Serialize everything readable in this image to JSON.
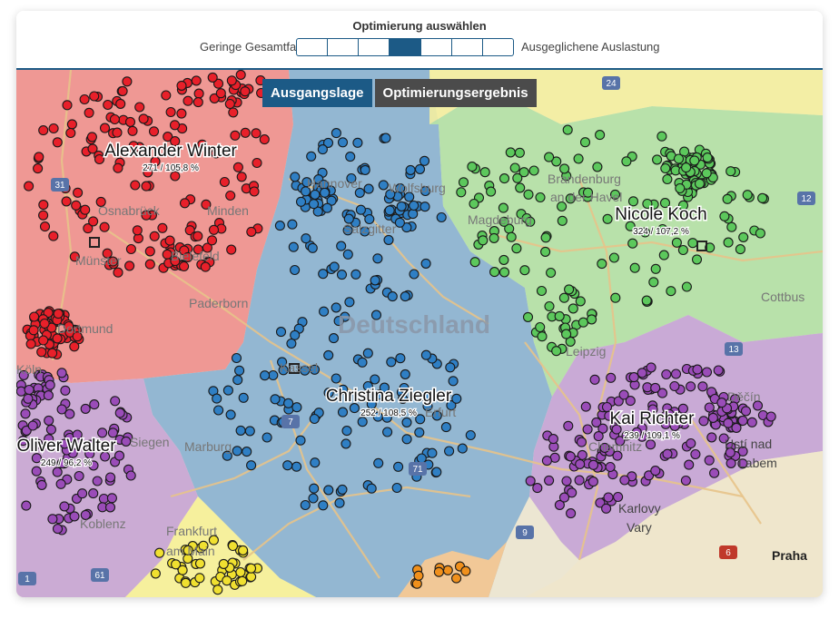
{
  "header": {
    "title": "Optimierung auswählen",
    "slider_left_label": "Geringe Gesamtfahrzeit",
    "slider_right_label": "Ausgeglichene Auslastung",
    "slider_segments": 7,
    "slider_selected_index": 3,
    "slider_color": "#1c5a86"
  },
  "tabs": [
    {
      "label": "Ausgangslage",
      "active": true
    },
    {
      "label": "Optimierungsergebnis",
      "active": false
    }
  ],
  "map": {
    "country_label": "Deutschland",
    "city_labels": [
      "Hannover",
      "Wolfsburg",
      "Osnabrück",
      "Minden",
      "Bielefeld",
      "Münster",
      "Paderborn",
      "Dortmund",
      "Köln",
      "Siegen",
      "Marburg",
      "Kassel",
      "Salzgitter",
      "Erfurt",
      "Magdeburg",
      "Brandenburg",
      "an der Havel",
      "Cottbus",
      "Leipzig",
      "Chemnitz",
      "Koblenz",
      "Frankfurt",
      "am Main",
      "Děčín",
      "Ústí nad",
      "Labem",
      "Karlovy",
      "Vary",
      "Praha"
    ],
    "road_numbers": [
      "31",
      "24",
      "12",
      "13",
      "7",
      "71",
      "9",
      "61",
      "1",
      "6"
    ],
    "territories": [
      {
        "name": "Alexander Winter",
        "stats": "271 / 105,8 %",
        "color": "#e8202a"
      },
      {
        "name": "Nicole Koch",
        "stats": "324 / 107,2 %",
        "color": "#5cc85c"
      },
      {
        "name": "Christina Ziegler",
        "stats": "252 / 108,5 %",
        "color": "#2f7fc4"
      },
      {
        "name": "Kai Richter",
        "stats": "239 / 109,1 %",
        "color": "#9a4cb8"
      },
      {
        "name": "Oliver Walter",
        "stats": "249 / 96,2 %",
        "color": "#9a4cb8"
      },
      {
        "name": "",
        "stats": "",
        "color": "#f0e030"
      },
      {
        "name": "",
        "stats": "",
        "color": "#f0901c"
      }
    ]
  }
}
